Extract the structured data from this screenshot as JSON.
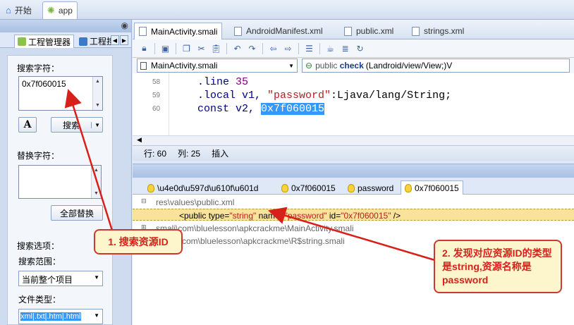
{
  "app_tabs": [
    {
      "label": "开始"
    },
    {
      "label": "app"
    }
  ],
  "left_panel": {
    "tabs": [
      {
        "label": "工程管理器"
      },
      {
        "label": "工程搜"
      }
    ],
    "search_label": "搜索字符：",
    "search_value": "0x7f060015",
    "search_button": "搜索",
    "replace_label": "替换字符：",
    "replace_all_button": "全部替换",
    "options_label": "搜索选项：",
    "scope_label": "搜索范围：",
    "scope_value": "当前整个项目",
    "filetype_label": "文件类型：",
    "filetype_value": "xml|.txt|.htm|.html"
  },
  "editor": {
    "doc_tabs": [
      {
        "label": "MainActivity.smali",
        "active": true
      },
      {
        "label": "AndroidManifest.xml",
        "active": false
      },
      {
        "label": "public.xml",
        "active": false
      },
      {
        "label": "strings.xml",
        "active": false
      }
    ],
    "file_combo": "MainActivity.smali",
    "method_combo_prefix": "public ",
    "method_combo_name": "check",
    "method_combo_sig": "(Landroid/view/View;)V",
    "lines": [
      {
        "num": "58",
        "a": ".line ",
        "b": "35",
        "c": "",
        "d": ""
      },
      {
        "num": "59",
        "a": ".local v1, ",
        "b": "\"password\"",
        "c": ":Ljava/lang/String;",
        "d": ""
      },
      {
        "num": "60",
        "a": "const v2, ",
        "b": "0x7f060015",
        "c": "",
        "d": ""
      }
    ],
    "status_row": "行: 60",
    "status_col": "列: 25",
    "status_mode": "插入"
  },
  "results": {
    "tabs": [
      {
        "label": "\\u4e0d\\u597d\\u610f\\u601d"
      },
      {
        "label": "0x7f060015"
      },
      {
        "label": "password"
      },
      {
        "label": "0x7f060015"
      }
    ],
    "file1": "res\\values\\public.xml",
    "match_pre": "<public type=",
    "match_type": "\"string\"",
    "match_mid": " name=",
    "match_name": "\"password\"",
    "match_id_label": " id=",
    "match_id": "\"0x7f060015\"",
    "match_end": " />",
    "file2": "smali\\com\\bluelesson\\apkcrackme\\MainActivity.smali",
    "file3": "com\\bluelesson\\apkcrackme\\R$string.smali"
  },
  "annotations": {
    "callout1": "1. 搜索资源ID",
    "callout2": "2. 发现对应资源ID的类型是string,资源名称是password"
  }
}
